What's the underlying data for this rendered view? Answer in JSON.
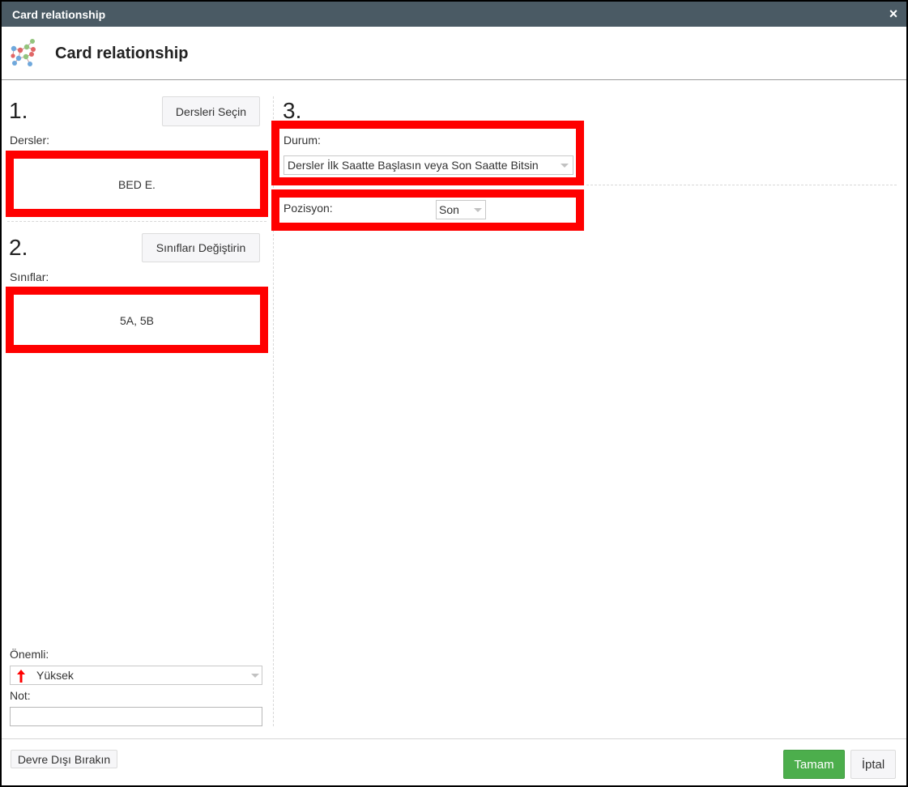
{
  "window": {
    "title": "Card relationship",
    "close_icon": "×"
  },
  "header": {
    "title": "Card relationship",
    "icon": "network-graph-icon"
  },
  "step1": {
    "number": "1.",
    "button_label": "Dersleri Seçin",
    "field_label": "Dersler:",
    "value": "BED E."
  },
  "step2": {
    "number": "2.",
    "button_label": "Sınıfları Değiştirin",
    "field_label": "Sınıflar:",
    "value": "5A, 5B"
  },
  "step3": {
    "number": "3.",
    "condition_label": "Durum:",
    "condition_value": "Dersler İlk Saatte Başlasın veya Son Saatte Bitsin",
    "position_label": "Pozisyon:",
    "position_value": "Son"
  },
  "importance": {
    "label": "Önemli:",
    "value": "Yüksek",
    "icon": "red-up-arrow-icon"
  },
  "note": {
    "label": "Not:",
    "value": ""
  },
  "footer": {
    "disable_label": "Devre Dışı Bırakın",
    "ok_label": "Tamam",
    "cancel_label": "İptal"
  },
  "colors": {
    "titlebar": "#4a5a64",
    "highlight": "#ff0000",
    "ok_button": "#4cae4c"
  }
}
